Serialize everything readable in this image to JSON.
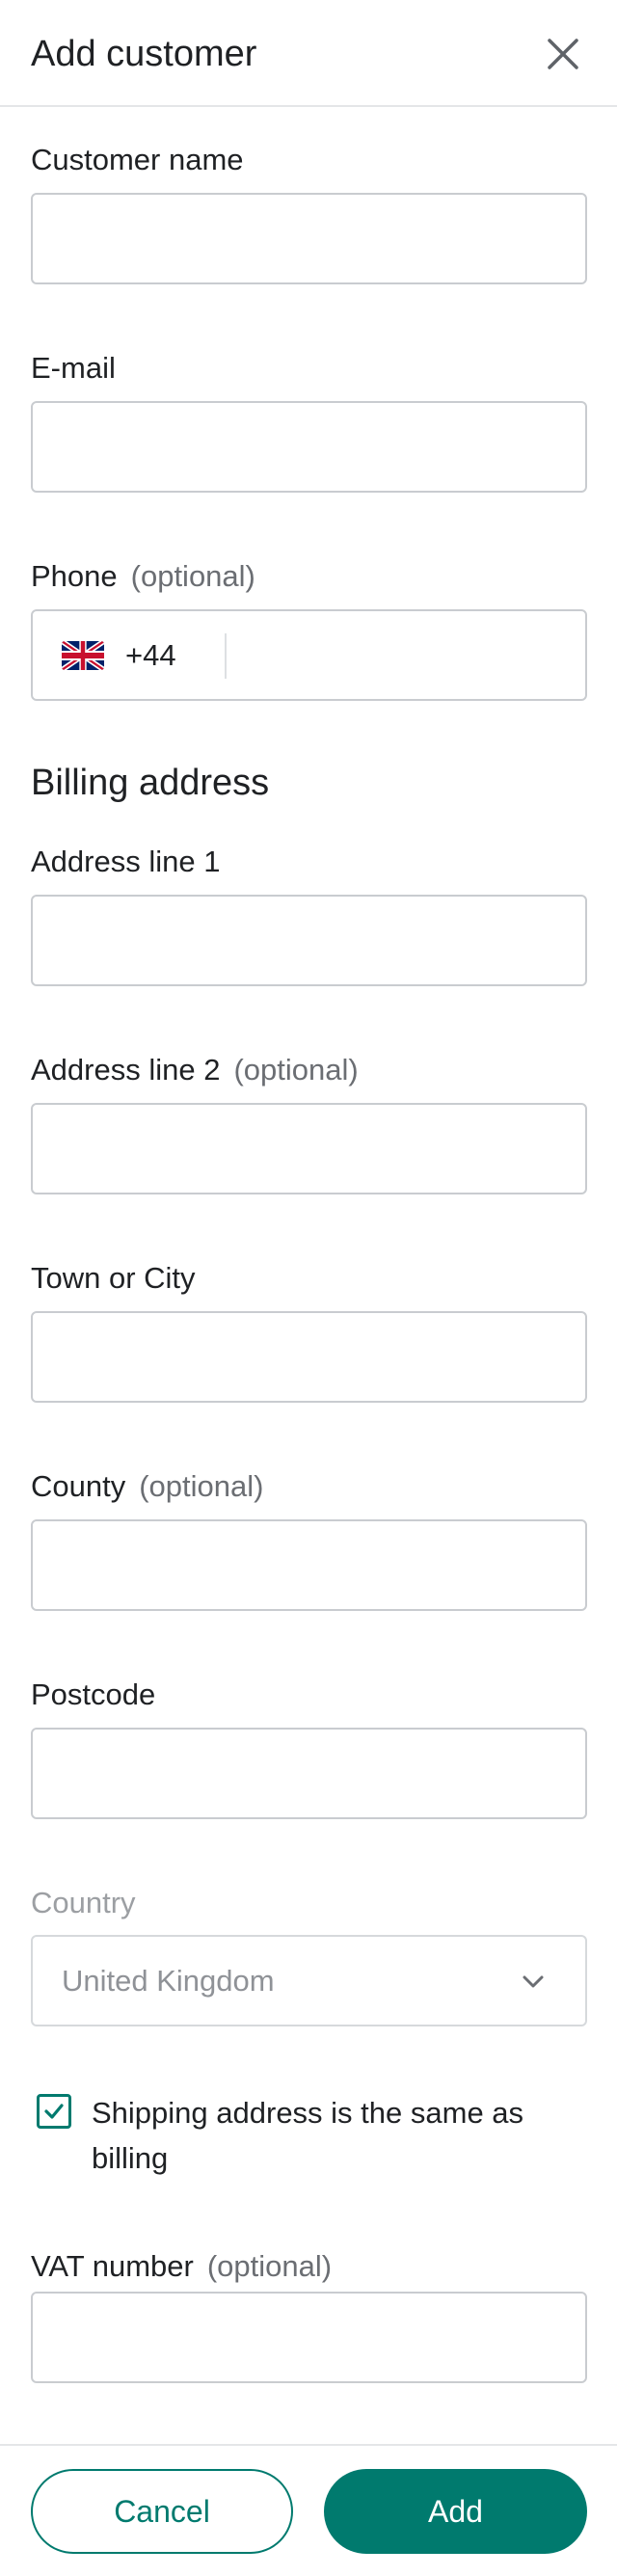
{
  "header": {
    "title": "Add customer",
    "close_icon": "close-icon"
  },
  "fields": {
    "customer_name": {
      "label": "Customer name",
      "value": "",
      "placeholder": ""
    },
    "email": {
      "label": "E-mail",
      "value": "",
      "placeholder": ""
    },
    "phone": {
      "label": "Phone",
      "optional": "(optional)",
      "country_flag": "uk-flag-icon",
      "dial_code": "+44",
      "value": ""
    }
  },
  "billing": {
    "title": "Billing address",
    "address_line_1": {
      "label": "Address line 1",
      "value": ""
    },
    "address_line_2": {
      "label": "Address line 2",
      "optional": "(optional)",
      "value": ""
    },
    "town_city": {
      "label": "Town or City",
      "value": ""
    },
    "county": {
      "label": "County",
      "optional": "(optional)",
      "value": ""
    },
    "postcode": {
      "label": "Postcode",
      "value": ""
    },
    "country": {
      "label": "Country",
      "selected": "United Kingdom",
      "chevron_icon": "chevron-down-icon"
    }
  },
  "shipping_same": {
    "label": "Shipping address is the same as billing",
    "checked": true,
    "icon": "checkmark-icon"
  },
  "vat": {
    "label": "VAT number",
    "optional": "(optional)",
    "value": ""
  },
  "footer": {
    "cancel_label": "Cancel",
    "add_label": "Add"
  },
  "colors": {
    "accent": "#007a6e",
    "border": "#c9ccd0",
    "text": "#1f2124",
    "muted_text": "#6b6e73"
  }
}
